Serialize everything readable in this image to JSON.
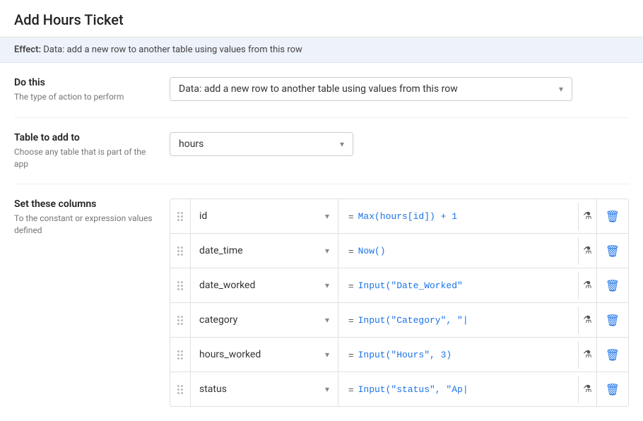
{
  "page": {
    "title": "Add Hours Ticket",
    "effect_label": "Effect:",
    "effect_value": "Data: add a new row to another table using values from this row"
  },
  "do_this": {
    "title": "Do this",
    "description": "The type of action to perform",
    "selected": "Data: add a new row to another table using values from this row"
  },
  "table_to_add_to": {
    "title": "Table to add to",
    "description": "Choose any table that is part of the app",
    "selected": "hours"
  },
  "set_columns": {
    "title": "Set these columns",
    "description": "To the constant or expression values defined",
    "rows": [
      {
        "col_name": "id",
        "expression": "= Max(hours[id]) + 1"
      },
      {
        "col_name": "date_time",
        "expression": "= Now()"
      },
      {
        "col_name": "date_worked",
        "expression": "= Input(\"Date_Worked\""
      },
      {
        "col_name": "category",
        "expression": "= Input(\"Category\", \"|"
      },
      {
        "col_name": "hours_worked",
        "expression": "= Input(\"Hours\", 3)"
      },
      {
        "col_name": "status",
        "expression": "= Input(\"status\", \"Ap|"
      }
    ]
  }
}
